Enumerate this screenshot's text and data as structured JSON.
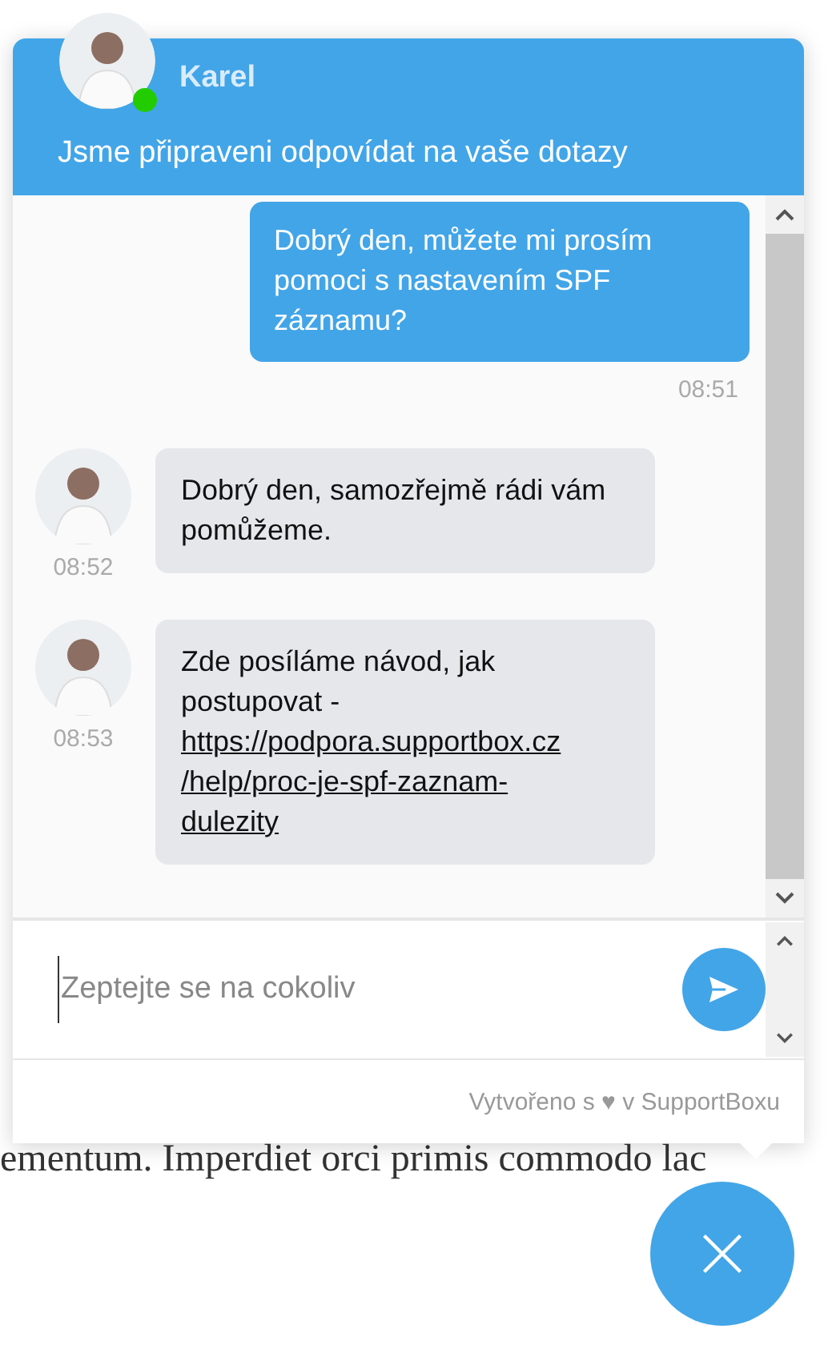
{
  "page": {
    "text": "ementum. Imperdiet orci primis commodo lac"
  },
  "header": {
    "agent_name": "Karel",
    "online": true,
    "tagline": "Jsme připraveni odpovídat na vaše dotazy"
  },
  "messages": [
    {
      "kind": "outgoing",
      "text": "Dobrý den, můžete mi prosím pomoci s nastavením SPF záznamu?",
      "time": "08:51"
    },
    {
      "kind": "incoming",
      "text": "Dobrý den, samozřejmě rádi vám pomůžeme.",
      "time": "08:52"
    },
    {
      "kind": "incoming",
      "text": "Zde posíláme návod, jak postupovat -",
      "link": "https://podpora.supportbox.cz/help/proc-je-spf-zaznam-dulezity",
      "time": "08:53"
    }
  ],
  "composer": {
    "placeholder": "Zeptejte se na cokoliv"
  },
  "footer": {
    "text": "Vytvořeno s ♥ v SupportBoxu"
  }
}
